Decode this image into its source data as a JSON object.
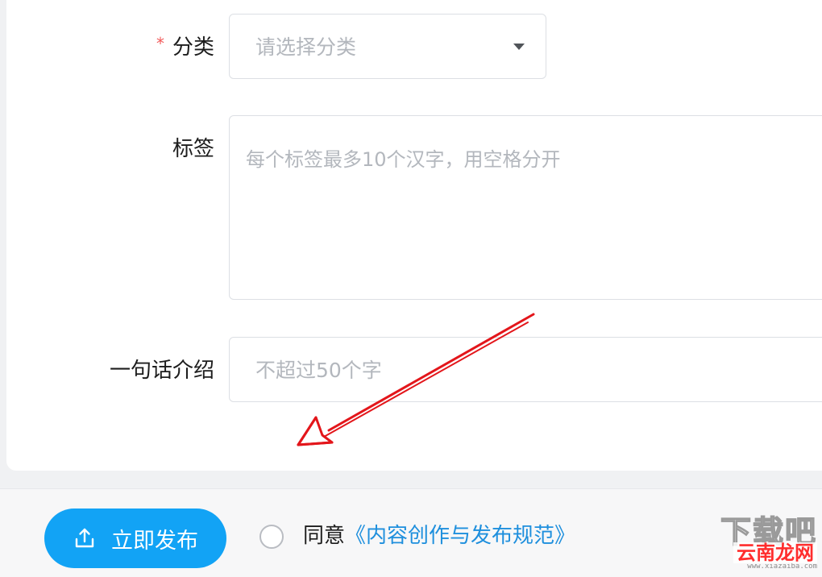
{
  "form": {
    "category": {
      "required_mark": "*",
      "label": "分类",
      "placeholder": "请选择分类"
    },
    "tags": {
      "label": "标签",
      "placeholder": "每个标签最多10个汉字，用空格分开"
    },
    "intro": {
      "label": "一句话介绍",
      "placeholder": "不超过50个字"
    }
  },
  "footer": {
    "publish_label": "立即发布",
    "agree_text": "同意",
    "agree_link": "《内容创作与发布规范》"
  },
  "watermark": {
    "top": "下载吧",
    "bottom": "云南龙网",
    "url": "www.xiazaiba.com"
  },
  "colors": {
    "accent": "#12a3f5",
    "link": "#1e8fdd",
    "required": "#f25a5a",
    "annotation": "#e3161b"
  }
}
